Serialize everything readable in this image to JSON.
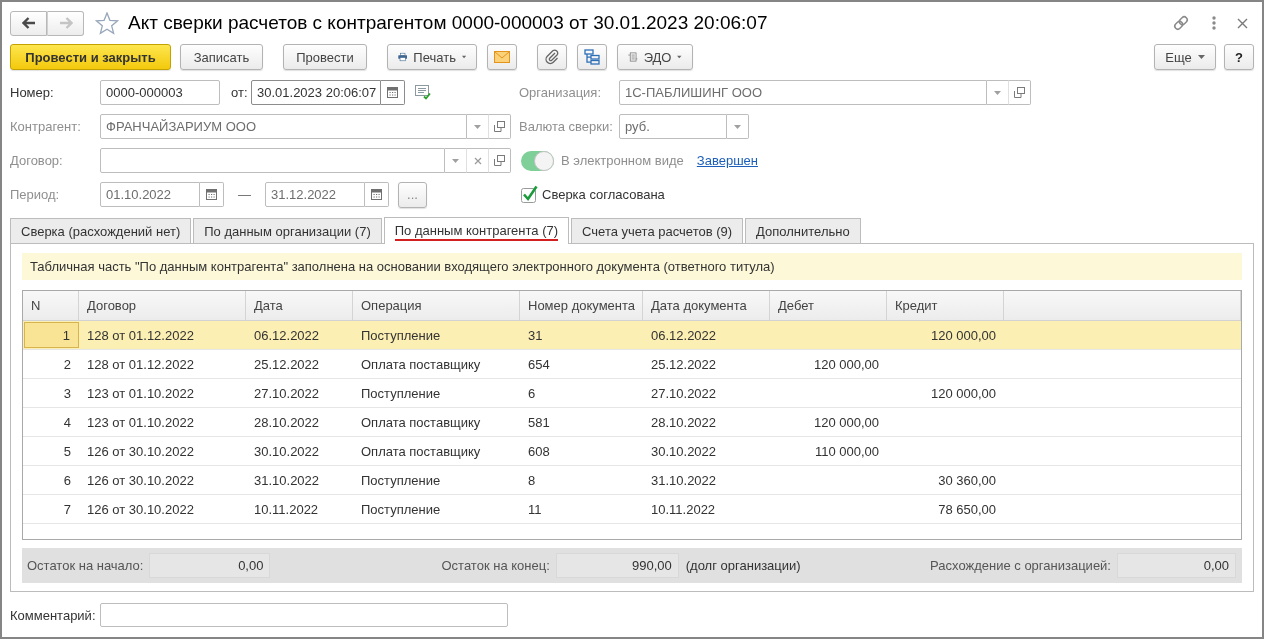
{
  "window": {
    "title": "Акт сверки расчетов с контрагентом 0000-000003 от 30.01.2023 20:06:07",
    "favorite": false
  },
  "navigation": {
    "back": {
      "disabled": false
    },
    "forward": {
      "disabled": true
    }
  },
  "toolbar": {
    "post_and_close": "Провести и закрыть",
    "save": "Записать",
    "post": "Провести",
    "print": "Печать",
    "edo": "ЭДО",
    "more": "Еще",
    "help": "?"
  },
  "number": {
    "label": "Номер:",
    "value": "0000-000003",
    "disabled": false
  },
  "date": {
    "label": "от:",
    "value": "30.01.2023 20:06:07"
  },
  "organization": {
    "label": "Организация:",
    "value": "1С-ПАБЛИШИНГ ООО",
    "disabled": true
  },
  "counterparty": {
    "label": "Контрагент:",
    "value": "ФРАНЧАЙЗАРИУМ ООО",
    "disabled": true
  },
  "currency": {
    "label": "Валюта сверки:",
    "value": "руб.",
    "disabled": true
  },
  "contract": {
    "label": "Договор:",
    "disabled": true
  },
  "electronic": {
    "label": "В электронном виде",
    "on": true,
    "disabled": true,
    "status_link": "Завершен"
  },
  "period": {
    "label": "Период:",
    "from": "01.10.2022",
    "separator": "—",
    "to": "31.12.2022",
    "select_button": "...",
    "disabled": true
  },
  "agreed": {
    "label": "Сверка согласована",
    "checked": true
  },
  "tabs": [
    {
      "label": "Сверка (расхождений нет)",
      "selected": false
    },
    {
      "label": "По данным организации (7)",
      "selected": false
    },
    {
      "label": "По данным контрагента (7)",
      "selected": true
    },
    {
      "label": "Счета учета расчетов (9)",
      "selected": false
    },
    {
      "label": "Дополнительно",
      "selected": false
    }
  ],
  "notice": "Табличная часть \"По данным контрагента\" заполнена на основании входящего электронного документа (ответного титула)",
  "table": {
    "columns": [
      "N",
      "Договор",
      "Дата",
      "Операция",
      "Номер документа",
      "Дата документа",
      "Дебет",
      "Кредит"
    ],
    "rows": [
      {
        "n": "1",
        "contract": "128 от 01.12.2022",
        "date": "06.12.2022",
        "operation": "Поступление",
        "doc_number": "31",
        "doc_date": "06.12.2022",
        "credit": "120 000,00",
        "selected": true
      },
      {
        "n": "2",
        "contract": "128 от 01.12.2022",
        "date": "25.12.2022",
        "operation": "Оплата поставщику",
        "doc_number": "654",
        "doc_date": "25.12.2022",
        "debit": "120 000,00",
        "selected": false
      },
      {
        "n": "3",
        "contract": "123 от 01.10.2022",
        "date": "27.10.2022",
        "operation": "Поступление",
        "doc_number": "6",
        "doc_date": "27.10.2022",
        "credit": "120 000,00",
        "selected": false
      },
      {
        "n": "4",
        "contract": "123 от 01.10.2022",
        "date": "28.10.2022",
        "operation": "Оплата поставщику",
        "doc_number": "581",
        "doc_date": "28.10.2022",
        "debit": "120 000,00",
        "selected": false
      },
      {
        "n": "5",
        "contract": "126 от 30.10.2022",
        "date": "30.10.2022",
        "operation": "Оплата поставщику",
        "doc_number": "608",
        "doc_date": "30.10.2022",
        "debit": "110 000,00",
        "selected": false
      },
      {
        "n": "6",
        "contract": "126 от 30.10.2022",
        "date": "31.10.2022",
        "operation": "Поступление",
        "doc_number": "8",
        "doc_date": "31.10.2022",
        "credit": "30 360,00",
        "selected": false
      },
      {
        "n": "7",
        "contract": "126 от 30.10.2022",
        "date": "10.11.2022",
        "operation": "Поступление",
        "doc_number": "11",
        "doc_date": "10.11.2022",
        "credit": "78 650,00",
        "selected": false
      }
    ]
  },
  "totals": {
    "opening_balance": {
      "label": "Остаток на начало:",
      "value": "0,00"
    },
    "closing_balance": {
      "label": "Остаток на конец:",
      "value": "990,00",
      "note": "(долг организации)"
    },
    "discrepancy": {
      "label": "Расхождение с организацией:",
      "value": "0,00"
    }
  },
  "comment": {
    "label": "Комментарий:"
  }
}
